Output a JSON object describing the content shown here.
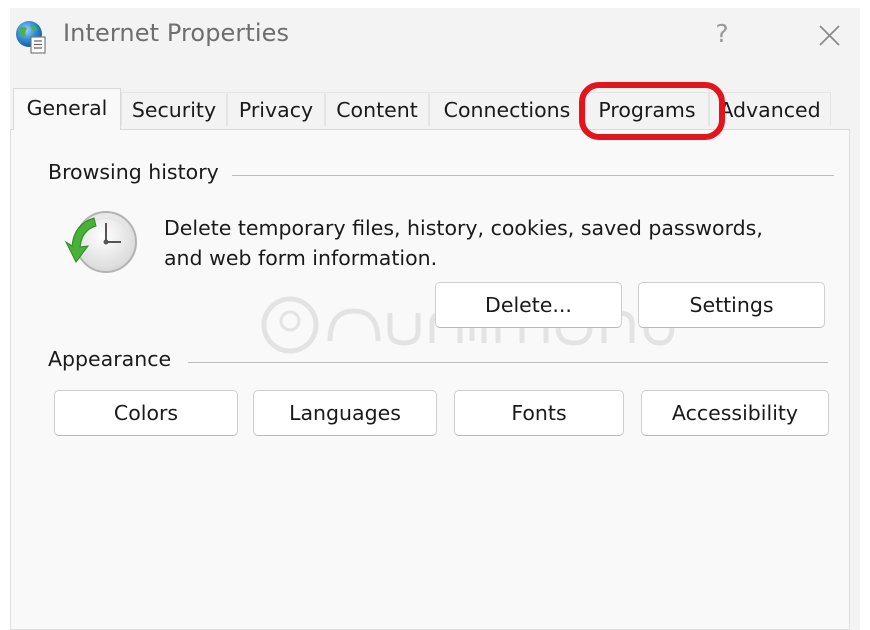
{
  "window": {
    "title": "Internet Properties",
    "help_label": "?",
    "icons": {
      "app": "globe-document-icon",
      "close": "close-icon"
    }
  },
  "tabs": [
    {
      "label": "General",
      "active": true
    },
    {
      "label": "Security",
      "active": false
    },
    {
      "label": "Privacy",
      "active": false
    },
    {
      "label": "Content",
      "active": false
    },
    {
      "label": "Connections",
      "active": false
    },
    {
      "label": "Programs",
      "active": false,
      "highlighted": true
    },
    {
      "label": "Advanced",
      "active": false
    }
  ],
  "browsing_history": {
    "heading": "Browsing history",
    "icon": "history-clock-icon",
    "description_line1": "Delete temporary files, history, cookies, saved passwords,",
    "description_line2": "and web form information.",
    "delete_label": "Delete...",
    "settings_label": "Settings"
  },
  "appearance": {
    "heading": "Appearance",
    "colors_label": "Colors",
    "languages_label": "Languages",
    "fonts_label": "Fonts",
    "accessibility_label": "Accessibility"
  },
  "annotation": {
    "highlight_color": "#e3141c"
  }
}
